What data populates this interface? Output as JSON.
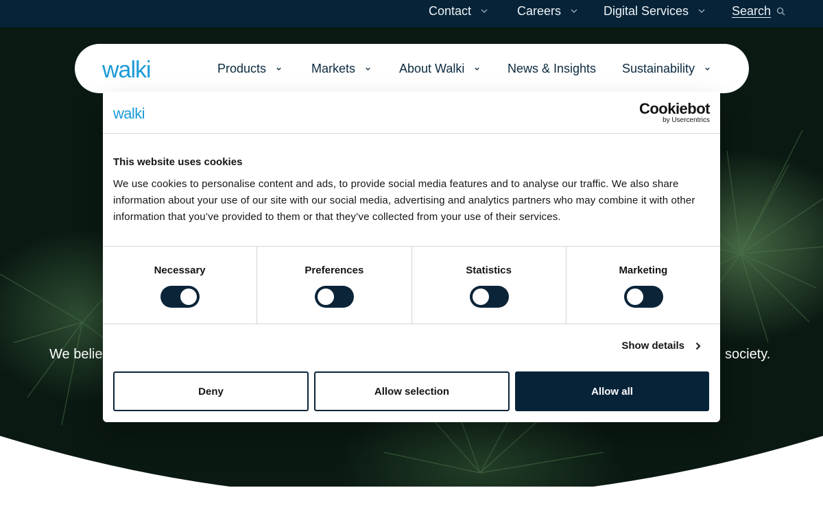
{
  "topbar": {
    "contact": "Contact",
    "careers": "Careers",
    "digital_services": "Digital Services",
    "search": "Search"
  },
  "nav": {
    "logo": "walki",
    "items": [
      "Products",
      "Markets",
      "About Walki",
      "News & Insights",
      "Sustainability"
    ]
  },
  "hero": {
    "text_left": "We belie",
    "text_right": "society."
  },
  "cookie": {
    "logo": "walki",
    "brand": "Cookiebot",
    "brand_sub": "by Usercentrics",
    "title": "This website uses cookies",
    "body": "We use cookies to personalise content and ads, to provide social media features and to analyse our traffic. We also share information about your use of our site with our social media, advertising and analytics partners who may combine it with other information that you’ve provided to them or that they’ve collected from your use of their services.",
    "categories": [
      {
        "label": "Necessary",
        "state": "on"
      },
      {
        "label": "Preferences",
        "state": "off"
      },
      {
        "label": "Statistics",
        "state": "off"
      },
      {
        "label": "Marketing",
        "state": "off"
      }
    ],
    "show_details": "Show details",
    "buttons": {
      "deny": "Deny",
      "allow_selection": "Allow selection",
      "allow_all": "Allow all"
    }
  },
  "colors": {
    "navy": "#062338",
    "brand_blue": "#1a9ad6",
    "toggle": "#0b2438"
  },
  "icons": [
    "chevron-down-icon",
    "search-icon",
    "chevron-right-icon"
  ]
}
